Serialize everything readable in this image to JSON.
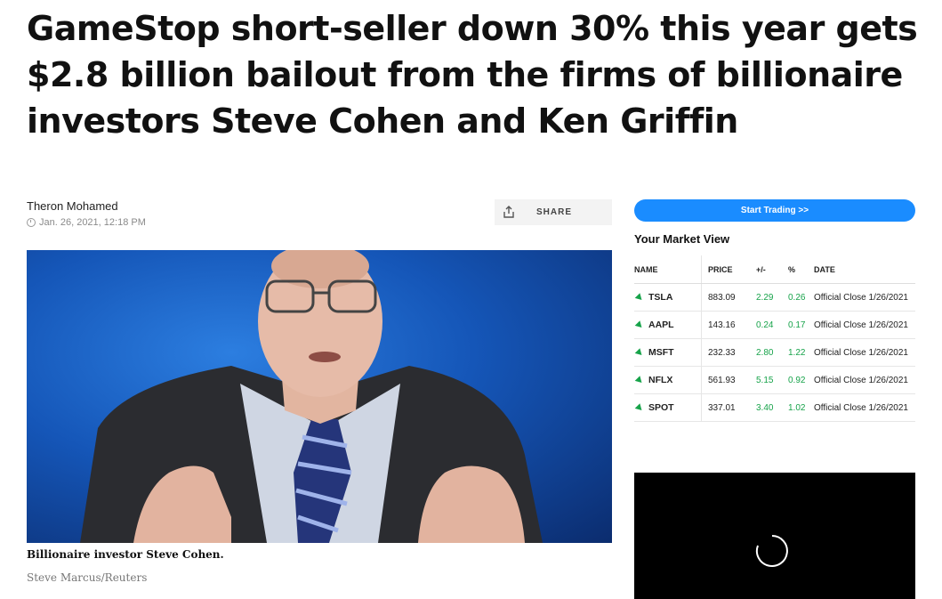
{
  "article": {
    "headline": "GameStop short-seller down 30% this year gets $2.8 billion bailout from the firms of billionaire investors Steve Cohen and Ken Griffin",
    "author": "Theron Mohamed",
    "date": "Jan. 26, 2021, 12:18 PM",
    "share_label": "SHARE",
    "image_caption": "Billionaire investor Steve Cohen.",
    "image_credit": "Steve Marcus/Reuters"
  },
  "sidebar": {
    "trade_button": "Start Trading >>",
    "market_title": "Your Market View",
    "columns": [
      "NAME",
      "PRICE",
      "+/-",
      "%",
      "DATE"
    ],
    "rows": [
      {
        "symbol": "TSLA",
        "price": "883.09",
        "change": "2.29",
        "pct": "0.26",
        "date": "Official Close 1/26/2021"
      },
      {
        "symbol": "AAPL",
        "price": "143.16",
        "change": "0.24",
        "pct": "0.17",
        "date": "Official Close 1/26/2021"
      },
      {
        "symbol": "MSFT",
        "price": "232.33",
        "change": "2.80",
        "pct": "1.22",
        "date": "Official Close 1/26/2021"
      },
      {
        "symbol": "NFLX",
        "price": "561.93",
        "change": "5.15",
        "pct": "0.92",
        "date": "Official Close 1/26/2021"
      },
      {
        "symbol": "SPOT",
        "price": "337.01",
        "change": "3.40",
        "pct": "1.02",
        "date": "Official Close 1/26/2021"
      }
    ]
  },
  "colors": {
    "accent": "#1a8cff",
    "gain": "#17a34a"
  }
}
